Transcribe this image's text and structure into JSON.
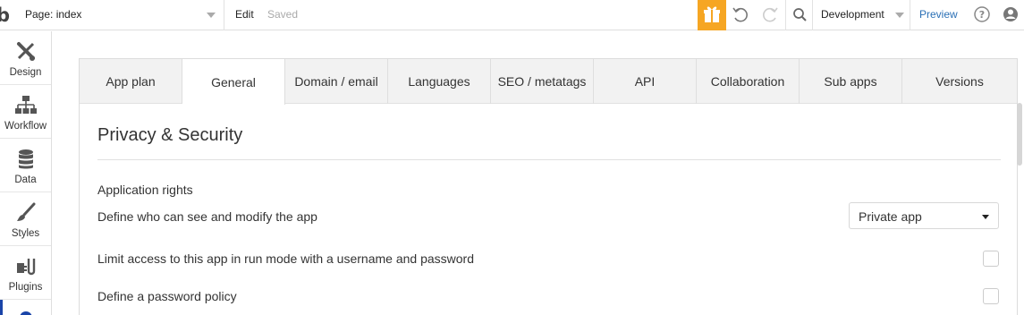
{
  "topbar": {
    "logo": "b",
    "page_selector": "Page: index",
    "edit_label": "Edit",
    "saved_label": "Saved",
    "environment": "Development",
    "preview_label": "Preview",
    "accent_color": "#f6a623",
    "icons": [
      "gift-icon",
      "undo-icon",
      "redo-icon",
      "search-icon",
      "help-icon",
      "user-icon"
    ]
  },
  "sidebar": {
    "items": [
      {
        "label": "Design",
        "icon": "design-icon"
      },
      {
        "label": "Workflow",
        "icon": "workflow-icon"
      },
      {
        "label": "Data",
        "icon": "database-icon"
      },
      {
        "label": "Styles",
        "icon": "brush-icon"
      },
      {
        "label": "Plugins",
        "icon": "plugin-icon"
      },
      {
        "label": "",
        "icon": "settings-icon"
      }
    ]
  },
  "tabs": [
    {
      "label": "App plan",
      "active": false
    },
    {
      "label": "General",
      "active": true
    },
    {
      "label": "Domain / email",
      "active": false
    },
    {
      "label": "Languages",
      "active": false
    },
    {
      "label": "SEO / metatags",
      "active": false
    },
    {
      "label": "API",
      "active": false
    },
    {
      "label": "Collaboration",
      "active": false
    },
    {
      "label": "Sub apps",
      "active": false
    },
    {
      "label": "Versions",
      "active": false
    }
  ],
  "content": {
    "title": "Privacy & Security",
    "section_label": "Application rights",
    "rights_label": "Define who can see and modify the app",
    "rights_value": "Private app",
    "limit_access_label": "Limit access to this app in run mode with a username and password",
    "password_policy_label": "Define a password policy"
  }
}
